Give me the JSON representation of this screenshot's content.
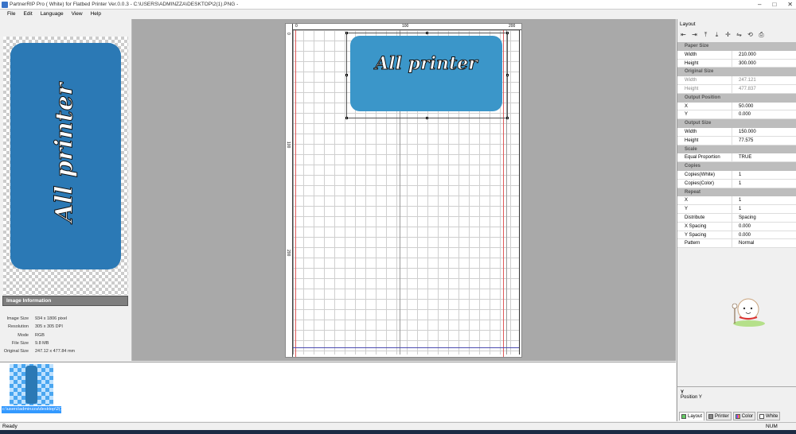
{
  "window": {
    "title": "PartnerRIP Pro ( White) for Flatbed Printer Ver.0.0.3 - C:\\USERS\\ADMINZZA\\DESKTOP\\2(1).PNG -",
    "min": "–",
    "max": "□",
    "close": "✕"
  },
  "menu": [
    "File",
    "Edit",
    "Language",
    "View",
    "Help"
  ],
  "thumbnail": {
    "text": "All printer"
  },
  "image_info": {
    "header": "Image Information",
    "rows": [
      {
        "k": "Image Size",
        "v": "934 x 1806 pixel"
      },
      {
        "k": "Resolution",
        "v": "305 x 305 DPI"
      },
      {
        "k": "Mode",
        "v": "RGB"
      },
      {
        "k": "File Size",
        "v": "9.8 MB"
      },
      {
        "k": "Original Size",
        "v": "247.12 x 477.84 mm"
      }
    ]
  },
  "canvas": {
    "ruler_unit": "mm",
    "ruler_top": [
      "0",
      "100",
      "200"
    ],
    "ruler_left": [
      "0",
      "100",
      "200"
    ],
    "print_text": "All printer"
  },
  "layout": {
    "title": "Layout",
    "toolbar_icons": [
      "align-left-icon",
      "align-right-icon",
      "align-top-icon",
      "align-bottom-icon",
      "center-icon",
      "flip-icon",
      "rotate-icon",
      "print-icon"
    ],
    "sections": [
      {
        "name": "Paper Size",
        "rows": [
          {
            "k": "Width",
            "v": "210.000"
          },
          {
            "k": "Height",
            "v": "300.000"
          }
        ]
      },
      {
        "name": "Original Size",
        "gray": true,
        "rows": [
          {
            "k": "Width",
            "v": "247.121"
          },
          {
            "k": "Height",
            "v": "477.837"
          }
        ]
      },
      {
        "name": "Output Position",
        "rows": [
          {
            "k": "X",
            "v": "50.000"
          },
          {
            "k": "Y",
            "v": "0.000"
          }
        ]
      },
      {
        "name": "Output Size",
        "rows": [
          {
            "k": "Width",
            "v": "150.000"
          },
          {
            "k": "Height",
            "v": "77.575"
          }
        ]
      },
      {
        "name": "Scale",
        "rows": [
          {
            "k": "Equal Proportion",
            "v": "TRUE"
          }
        ]
      },
      {
        "name": "Copies",
        "rows": [
          {
            "k": "Copies(White)",
            "v": "1"
          },
          {
            "k": "Copies(Color)",
            "v": "1"
          }
        ]
      },
      {
        "name": "Repeat",
        "rows": [
          {
            "k": "X",
            "v": "1"
          },
          {
            "k": "Y",
            "v": "1"
          },
          {
            "k": "Distribute",
            "v": "Spacing"
          },
          {
            "k": "X Spacing",
            "v": "0.000"
          },
          {
            "k": "Y Spacing",
            "v": "0.000"
          },
          {
            "k": "Pattern",
            "v": "Normal"
          }
        ]
      }
    ],
    "desc_title": "Y",
    "desc_text": "Position Y",
    "tabs": [
      "Layout",
      "Printer",
      "Color",
      "White"
    ]
  },
  "file_strip": {
    "label": "c:\\users\\adminzza\\desktop\\2(1).png"
  },
  "status": {
    "left": "Ready",
    "right": "NUM"
  }
}
